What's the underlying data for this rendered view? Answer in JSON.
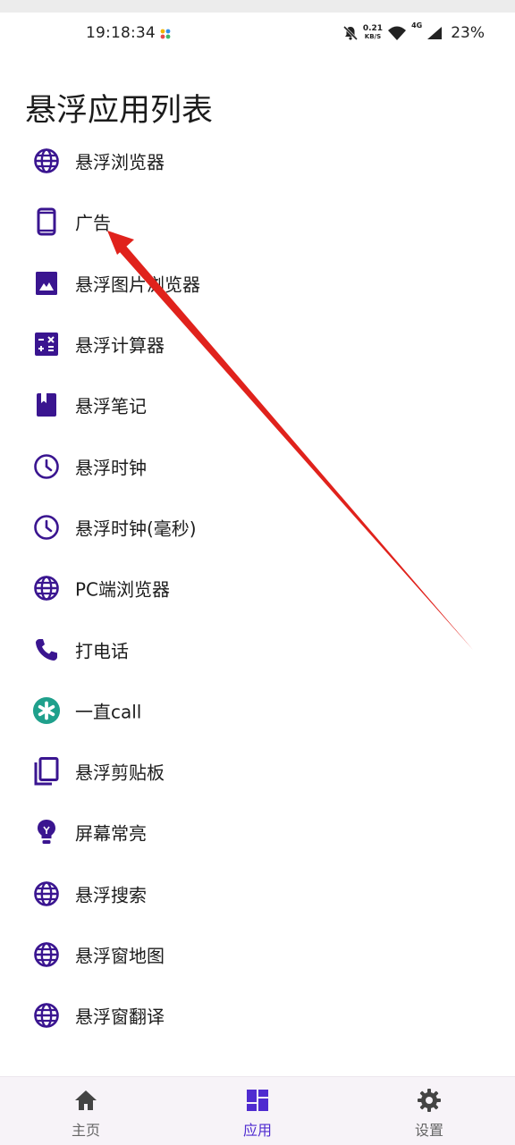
{
  "status_bar": {
    "time": "19:18:34",
    "speed_value": "0.21",
    "speed_unit": "KB/S",
    "network": "4G",
    "battery": "23%"
  },
  "title": "悬浮应用列表",
  "apps": [
    {
      "label": "悬浮浏览器",
      "icon": "globe-icon"
    },
    {
      "label": "广告",
      "icon": "phone-frame-icon"
    },
    {
      "label": "悬浮图片浏览器",
      "icon": "image-icon"
    },
    {
      "label": "悬浮计算器",
      "icon": "calculator-icon"
    },
    {
      "label": "悬浮笔记",
      "icon": "bookmark-note-icon"
    },
    {
      "label": "悬浮时钟",
      "icon": "clock-icon"
    },
    {
      "label": "悬浮时钟(毫秒)",
      "icon": "clock-icon"
    },
    {
      "label": "PC端浏览器",
      "icon": "globe-icon"
    },
    {
      "label": "打电话",
      "icon": "phone-icon"
    },
    {
      "label": "一直call",
      "icon": "teal-asterisk-icon"
    },
    {
      "label": "悬浮剪贴板",
      "icon": "copy-icon"
    },
    {
      "label": "屏幕常亮",
      "icon": "lightbulb-icon"
    },
    {
      "label": "悬浮搜索",
      "icon": "globe-icon"
    },
    {
      "label": "悬浮窗地图",
      "icon": "globe-icon"
    },
    {
      "label": "悬浮窗翻译",
      "icon": "globe-icon"
    }
  ],
  "bottom_nav": [
    {
      "label": "主页",
      "icon": "home-icon",
      "active": false
    },
    {
      "label": "应用",
      "icon": "dashboard-icon",
      "active": true
    },
    {
      "label": "设置",
      "icon": "gear-icon",
      "active": false
    }
  ],
  "colors": {
    "icon_accent": "#3a1590",
    "nav_active": "#4f2bd0",
    "annotation_arrow": "#e0221c",
    "teal_badge": "#1fa08c"
  }
}
